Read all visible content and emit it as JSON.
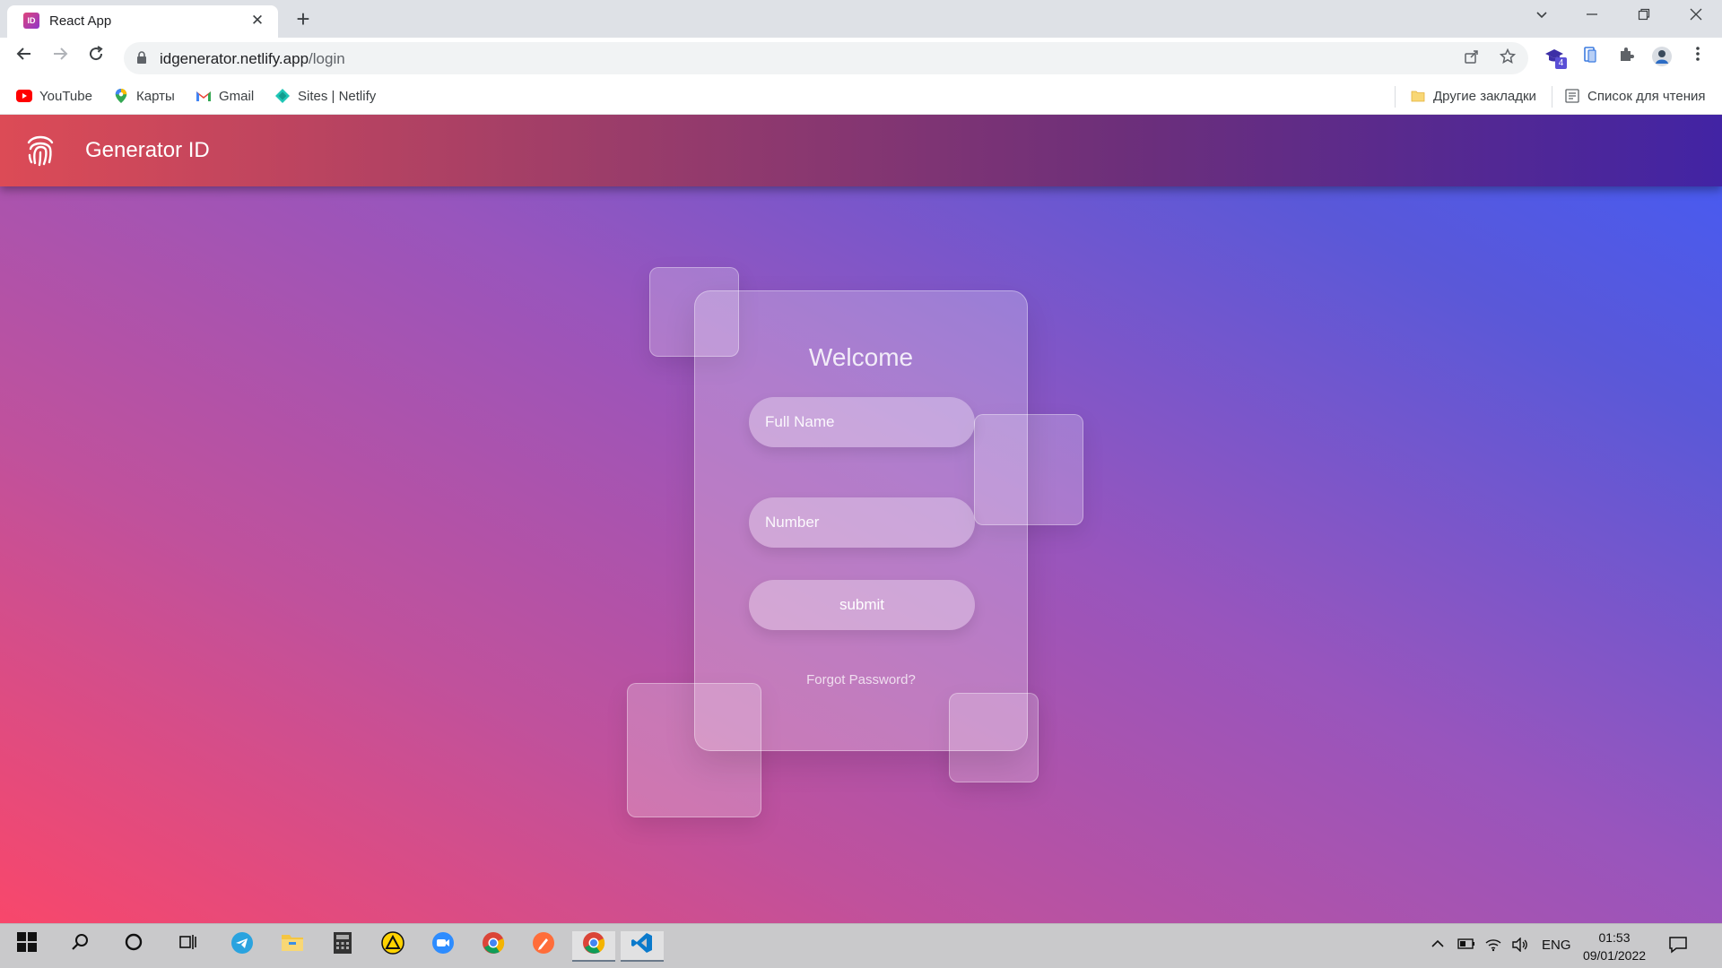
{
  "browser": {
    "tab": {
      "favicon_text": "ID",
      "title": "React App",
      "close": "✕"
    },
    "new_tab": "+",
    "url_host": "idgenerator.netlify.app",
    "url_path": "/login"
  },
  "bookmarks": [
    {
      "label": "YouTube",
      "icon": "youtube-icon"
    },
    {
      "label": "Карты",
      "icon": "maps-icon"
    },
    {
      "label": "Gmail",
      "icon": "gmail-icon"
    },
    {
      "label": "Sites | Netlify",
      "icon": "netlify-icon"
    }
  ],
  "bookmarks_right": {
    "other": "Другие закладки",
    "reading_list": "Список для чтения"
  },
  "extension_badge": "4",
  "app": {
    "brand": "Generator ID",
    "header_gradient": [
      "#dc4b56",
      "#9c3d69",
      "#6d2f7a",
      "#4224a4"
    ],
    "background_gradient": [
      "#f8476b",
      "#c0519c",
      "#9855bd",
      "#5a58d8",
      "#445bf6"
    ]
  },
  "login": {
    "title": "Welcome",
    "full_name_placeholder": "Full Name",
    "number_placeholder": "Number",
    "submit_label": "submit",
    "forgot_label": "Forgot Password?"
  },
  "taskbar": {
    "language": "ENG",
    "time": "01:53",
    "date": "09/01/2022"
  }
}
